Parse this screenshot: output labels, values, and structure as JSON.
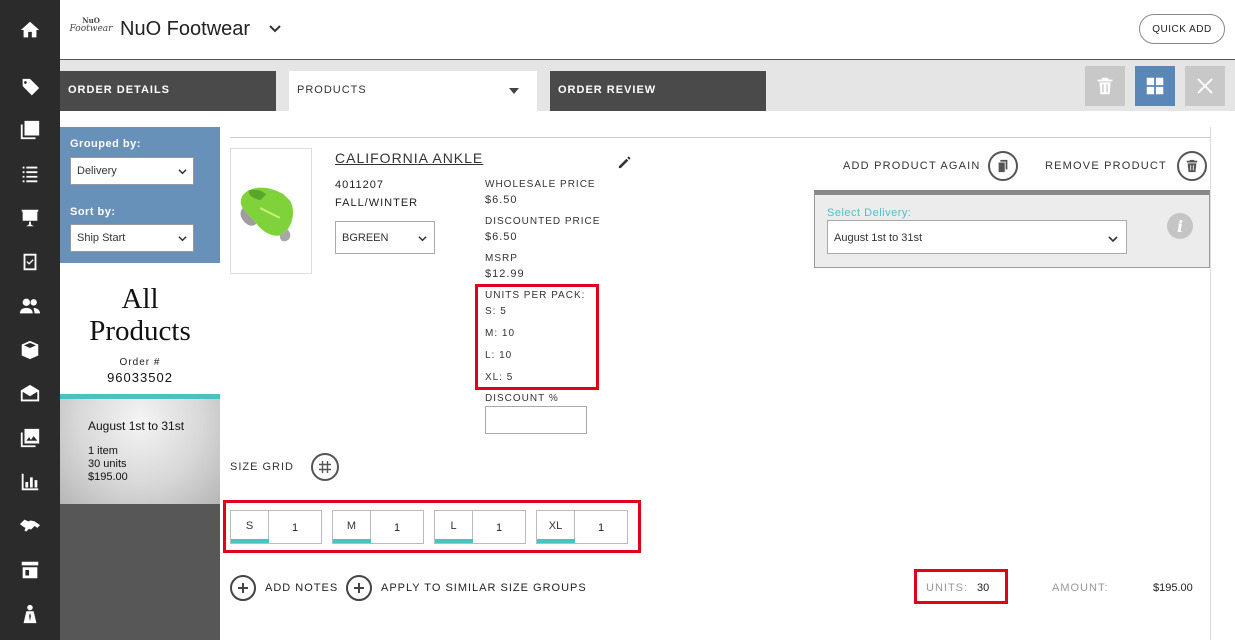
{
  "rail": {
    "icons": [
      "home-icon",
      "tag-icon",
      "catalog-icon",
      "list-icon",
      "presentation-icon",
      "checklist-icon",
      "customers-icon",
      "box-icon",
      "envelope-icon",
      "images-icon",
      "reports-icon",
      "handshake-icon",
      "store-icon",
      "sales-rep-icon"
    ]
  },
  "header": {
    "logo_line1": "NuO",
    "logo_line2": "Footwear",
    "brand": "NuO Footwear",
    "quick_add": "QUICK ADD"
  },
  "tabs": [
    {
      "label": "ORDER DETAILS"
    },
    {
      "label": "PRODUCTS"
    },
    {
      "label": "ORDER REVIEW"
    }
  ],
  "sidebar": {
    "grouped_by_label": "Grouped by:",
    "grouped_by_value": "Delivery",
    "sort_by_label": "Sort by:",
    "sort_by_value": "Ship Start",
    "title_line1": "All",
    "title_line2": "Products",
    "order_label": "Order #",
    "order_number": "96033502",
    "delivery_name": "August 1st to 31st",
    "items": "1 item",
    "units": "30 units",
    "total": "$195.00"
  },
  "product": {
    "name": "CALIFORNIA ANKLE",
    "sku": "4011207",
    "season": "FALL/WINTER",
    "color": "BGREEN",
    "wholesale_label": "WHOLESALE PRICE",
    "wholesale_value": "$6.50",
    "discounted_label": "DISCOUNTED PRICE",
    "discounted_value": "$6.50",
    "msrp_label": "MSRP",
    "msrp_value": "$12.99",
    "units_per_pack_label": "UNITS PER PACK:",
    "units_per_pack": [
      "S: 5",
      "M: 10",
      "L: 10",
      "XL: 5"
    ],
    "discount_label": "DISCOUNT %",
    "discount_value": ""
  },
  "actions": {
    "add_again": "ADD PRODUCT AGAIN",
    "remove": "REMOVE PRODUCT"
  },
  "delivery": {
    "label": "Select Delivery:",
    "value": "August 1st to 31st"
  },
  "size_grid": {
    "label": "SIZE GRID",
    "sizes": [
      {
        "size": "S",
        "qty": "1"
      },
      {
        "size": "M",
        "qty": "1"
      },
      {
        "size": "L",
        "qty": "1"
      },
      {
        "size": "XL",
        "qty": "1"
      }
    ]
  },
  "footer": {
    "add_notes": "ADD NOTES",
    "apply_similar": "APPLY TO SIMILAR SIZE GROUPS",
    "units_label": "UNITS:",
    "units_value": "30",
    "amount_label": "AMOUNT:",
    "amount_value": "$195.00"
  },
  "colors": {
    "rail": "#2b2b2b",
    "sidebar_blue": "#6891b9",
    "teal": "#48c3c3",
    "highlight_red": "#e0001b",
    "toolbar_active": "#5b86b8"
  }
}
